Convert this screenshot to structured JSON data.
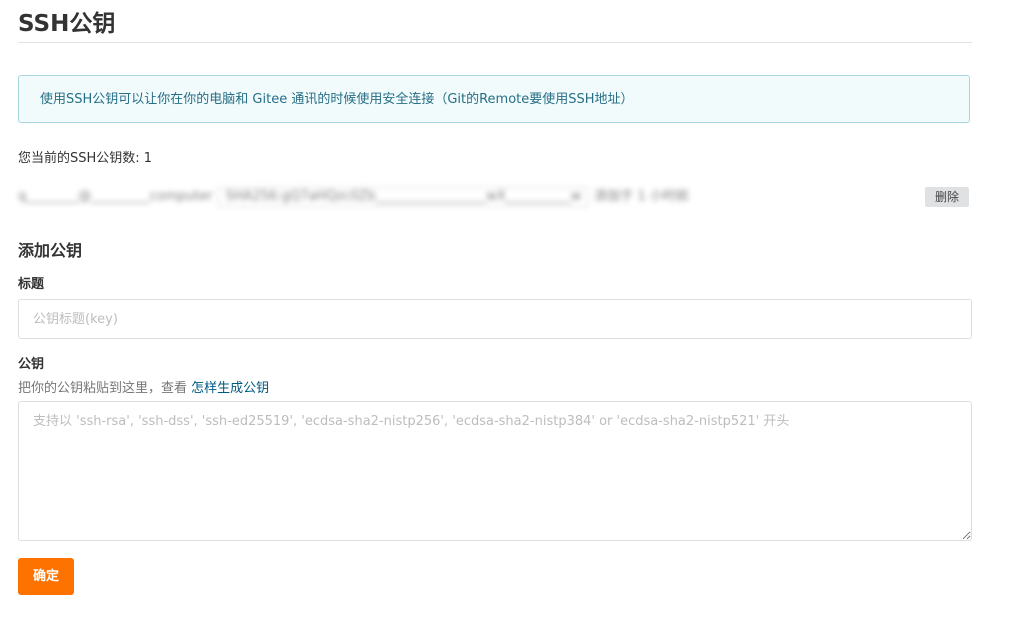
{
  "page": {
    "title": "SSH公钥"
  },
  "info": {
    "text": "使用SSH公钥可以让你在你的电脑和 Gitee 通讯的时候使用安全连接（Git的Remote要使用SSH地址）"
  },
  "keys": {
    "count_text": "您当前的SSH公钥数: 1",
    "items": [
      {
        "name": "q________@_________computer",
        "fingerprint": "SHA256:gQ7aHQzc0Zb_________________wX__________w",
        "added": "添加于 1 小时前",
        "delete_label": "删除"
      }
    ]
  },
  "add_key": {
    "heading": "添加公钥",
    "title_label": "标题",
    "title_placeholder": "公钥标题(key)",
    "title_value": "",
    "key_label": "公钥",
    "key_hint_prefix": "把你的公钥粘贴到这里，查看 ",
    "key_hint_link": "怎样生成公钥",
    "key_placeholder": "支持以 'ssh-rsa', 'ssh-dss', 'ssh-ed25519', 'ecdsa-sha2-nistp256', 'ecdsa-sha2-nistp384' or 'ecdsa-sha2-nistp521' 开头",
    "key_value": "",
    "submit_label": "确定"
  },
  "colors": {
    "accent": "#fe7300",
    "info_background": "#f1fbfc",
    "info_border": "#a9d5de",
    "info_text": "#276f86",
    "link": "#005980"
  }
}
